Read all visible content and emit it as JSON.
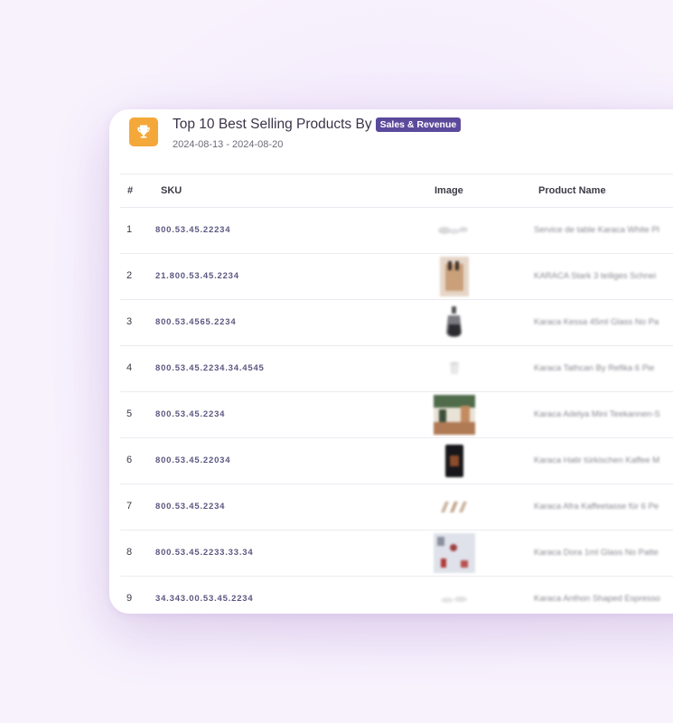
{
  "header": {
    "title": "Top 10 Best Selling Products By",
    "badge": "Sales & Revenue",
    "date_range": "2024-08-13 - 2024-08-20",
    "icon": "trophy-icon",
    "icon_bg": "#f5a83a",
    "badge_color": "#5b4a9c"
  },
  "table": {
    "columns": {
      "num": "#",
      "sku": "SKU",
      "image": "Image",
      "name": "Product Name"
    },
    "rows": [
      {
        "num": "1",
        "sku": "800.53.45.22234",
        "name": "Service de table Karaca White Pl"
      },
      {
        "num": "2",
        "sku": "21.800.53.45.2234",
        "name": "KARACA Stark 3 teiliges Schnei"
      },
      {
        "num": "3",
        "sku": "800.53.4565.2234",
        "name": "Karaca Kessa 45ml Glass No Pa"
      },
      {
        "num": "4",
        "sku": "800.53.45.2234.34.4545",
        "name": "Karaca Tathcan By Refika 6 Pie"
      },
      {
        "num": "5",
        "sku": "800.53.45.2234",
        "name": "Karaca Adelya Mini Teekannen-S"
      },
      {
        "num": "6",
        "sku": "800.53.45.22034",
        "name": "Karaca Hatir türkischen Kaffee M"
      },
      {
        "num": "7",
        "sku": "800.53.45.2234",
        "name": "Karaca Afra Kaffeetasse für 6 Pe"
      },
      {
        "num": "8",
        "sku": "800.53.45.2233.33.34",
        "name": "Karaca Dora 1ml Glass No Patte"
      },
      {
        "num": "9",
        "sku": "34.343.00.53.45.2234",
        "name": "Karaca Anthon Shaped Espresso"
      }
    ]
  }
}
